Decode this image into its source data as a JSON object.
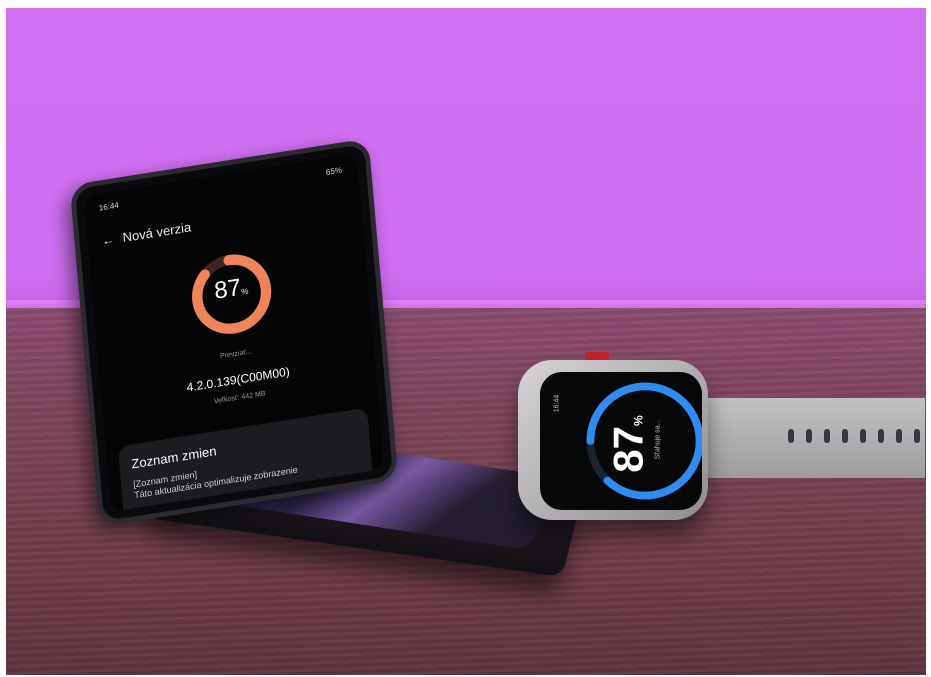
{
  "phone": {
    "status_time": "16:44",
    "status_right": "65%",
    "header_title": "Nová verzia",
    "progress_percent": 87,
    "progress_value": "87",
    "progress_unit": "%",
    "progress_status": "Prevziať...",
    "version": "4.2.0.139(C00M00)",
    "size": "Veľkosť: 442 MB",
    "changes_title": "Zoznam zmien",
    "changes_lines": [
      "[Zoznam zmien]",
      "Táto aktualizácia optimalizuje zobrazenie"
    ],
    "ring_color": "#f0845a"
  },
  "watch": {
    "time": "16:44",
    "progress_percent": 87,
    "progress_value": "87",
    "progress_unit": "%",
    "status": "Sťahuje sa...",
    "ring_color": "#2f8cf0"
  }
}
